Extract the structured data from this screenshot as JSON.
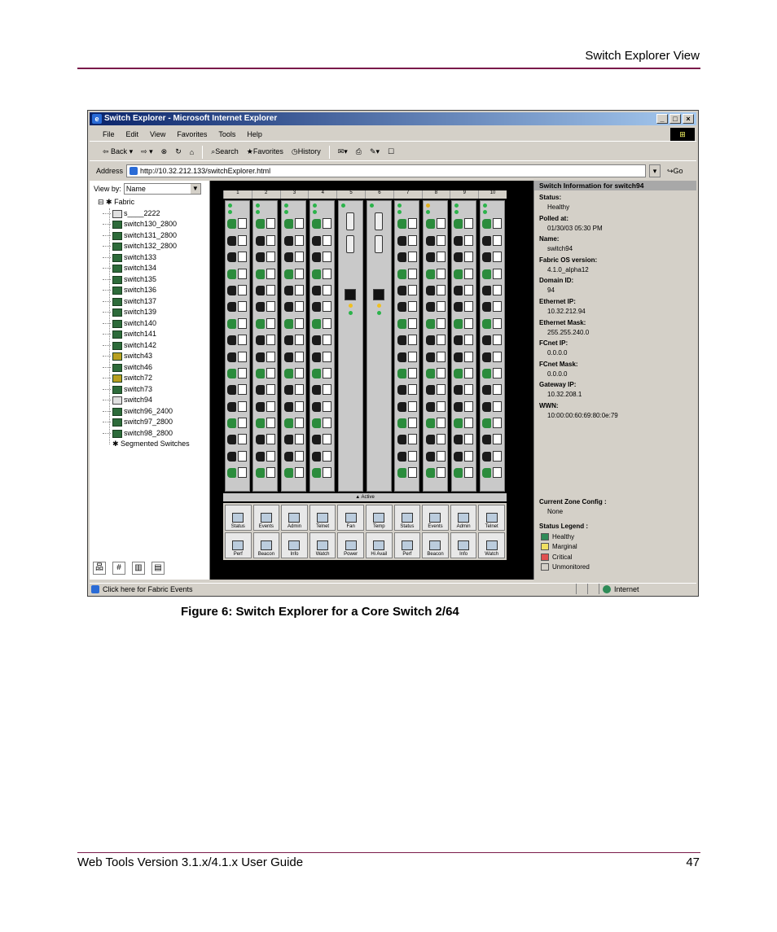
{
  "page": {
    "running_head": "Switch Explorer View",
    "caption": "Figure 6:  Switch Explorer for a Core Switch 2/64",
    "footer_left": "Web Tools Version 3.1.x/4.1.x User Guide",
    "page_number": "47"
  },
  "browser": {
    "title": "Switch Explorer - Microsoft Internet Explorer",
    "window_buttons": [
      "_",
      "□",
      "×"
    ],
    "menu": [
      "File",
      "Edit",
      "View",
      "Favorites",
      "Tools",
      "Help"
    ],
    "toolbar": [
      "Back",
      "Search",
      "Favorites",
      "History"
    ],
    "address_label": "Address",
    "address_value": "http://10.32.212.133/switchExplorer.html",
    "go_label": "Go",
    "status_text": "Click here for Fabric Events",
    "status_zone": "Internet"
  },
  "left_pane": {
    "view_by_label": "View by:",
    "view_by_value": "Name",
    "root": "Fabric",
    "switches": [
      {
        "name": "s____2222",
        "icon": "w"
      },
      {
        "name": "switch130_2800",
        "icon": "g"
      },
      {
        "name": "switch131_2800",
        "icon": "g"
      },
      {
        "name": "switch132_2800",
        "icon": "g"
      },
      {
        "name": "switch133",
        "icon": "g"
      },
      {
        "name": "switch134",
        "icon": "g"
      },
      {
        "name": "switch135",
        "icon": "g"
      },
      {
        "name": "switch136",
        "icon": "g"
      },
      {
        "name": "switch137",
        "icon": "g"
      },
      {
        "name": "switch139",
        "icon": "g"
      },
      {
        "name": "switch140",
        "icon": "g"
      },
      {
        "name": "switch141",
        "icon": "g"
      },
      {
        "name": "switch142",
        "icon": "g"
      },
      {
        "name": "switch43",
        "icon": "y"
      },
      {
        "name": "switch46",
        "icon": "g"
      },
      {
        "name": "switch72",
        "icon": "y"
      },
      {
        "name": "switch73",
        "icon": "g"
      },
      {
        "name": "switch94",
        "icon": "w"
      },
      {
        "name": "switch96_2400",
        "icon": "g"
      },
      {
        "name": "switch97_2800",
        "icon": "g"
      },
      {
        "name": "switch98_2800",
        "icon": "g"
      }
    ],
    "segmented": "Segmented Switches"
  },
  "chassis": {
    "slots": [
      "1",
      "2",
      "3",
      "4",
      "5",
      "6",
      "7",
      "8",
      "9",
      "10"
    ],
    "active_label": "Active",
    "buttons_top": [
      "Status",
      "Events",
      "Admin",
      "Telnet",
      "Fan",
      "Temp",
      "Status",
      "Events",
      "Admin",
      "Telnet"
    ],
    "buttons_bottom": [
      "Perf",
      "Beacon",
      "Info",
      "Watch",
      "Power",
      "Hi Avail",
      "Perf",
      "Beacon",
      "Info",
      "Watch"
    ]
  },
  "info": {
    "title": "Switch Information for switch94",
    "fields": [
      {
        "label": "Status:",
        "value": "Healthy"
      },
      {
        "label": "Polled at:",
        "value": "01/30/03 05:30 PM"
      },
      {
        "label": "Name:",
        "value": "switch94"
      },
      {
        "label": "Fabric OS version:",
        "value": "4.1.0_alpha12"
      },
      {
        "label": "Domain ID:",
        "value": "94"
      },
      {
        "label": "Ethernet IP:",
        "value": "10.32.212.94"
      },
      {
        "label": "Ethernet Mask:",
        "value": "255.255.240.0"
      },
      {
        "label": "FCnet IP:",
        "value": "0.0.0.0"
      },
      {
        "label": "FCnet Mask:",
        "value": "0.0.0.0"
      },
      {
        "label": "Gateway IP:",
        "value": "10.32.208.1"
      },
      {
        "label": "WWN:",
        "value": "10:00:00:60:69:80:0e:79"
      }
    ],
    "zone_label": "Current Zone Config :",
    "zone_value": "None",
    "legend_label": "Status Legend :",
    "legend": [
      {
        "name": "Healthy",
        "color": "#2e8b57"
      },
      {
        "name": "Marginal",
        "color": "#f0e060"
      },
      {
        "name": "Critical",
        "color": "#e05050"
      },
      {
        "name": "Unmonitored",
        "color": "#d4d0c8"
      }
    ]
  }
}
